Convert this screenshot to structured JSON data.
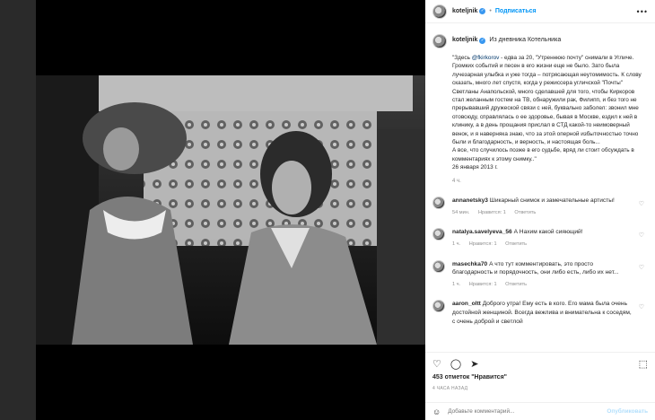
{
  "header": {
    "username": "koteljnik",
    "follow_label": "Подписаться",
    "more": "•••"
  },
  "caption": {
    "username": "koteljnik",
    "location": "Из дневника Котельника",
    "text_before": "\"Здесь ",
    "mention": "@fkirkorov",
    "text_after": " - едва за 20, \"Утреннюю почту\" снимали в Угличе. Громких событий и песен в его жизни еще не было. Зато была лучезарная улыбка и уже тогда – потрясающая неутомимость. К слову сказать, много лет спустя, когда у режиссера угличской \"Почты\" Светланы Анапольской, много сделавшей для того, чтобы Киркоров стал желанным гостем на ТВ, обнаружили рак, Филипп, и без того не прерывавший дружеской связи с ней, буквально заболел: звонил мне отовсюду, справлялась о ее здоровье, бывая в Москве, ездил к ней в клинику, а в день прощания прислал в СТД какой-то неимоверный венок, и я наверняка знаю, что за этой оперной избыточностью точно были и благодарность, и верность, и настоящая боль...\nА все, что случилось позже в его судьбе, вряд ли стоит обсуждать в комментариях к этому снимку..\"\n26 января 2013 г.",
    "age": "4 ч."
  },
  "comments": [
    {
      "user": "annanetsky3",
      "text": "Шикарный снимок и замечательные артисты!",
      "age": "54 мин.",
      "likes": "Нравится: 1",
      "reply": "Ответить"
    },
    {
      "user": "natalya.savelyeva_56",
      "text": "А Нахим какой сияющий!",
      "age": "1 ч.",
      "likes": "Нравится: 1",
      "reply": "Ответить"
    },
    {
      "user": "masechka70",
      "text": "А что тут комментировать, это просто благодарность и порядочность, они либо есть, либо их нет...",
      "age": "1 ч.",
      "likes": "Нравится: 1",
      "reply": "Ответить"
    },
    {
      "user": "aaron_oltt",
      "text": "Доброго утра! Ему есть в кого. Его мама была очень достойной женщиной. Всегда вежлива и внимательна к соседям, с очень доброй и светлой",
      "age": "",
      "likes": "",
      "reply": ""
    }
  ],
  "actions": {
    "likes_text": "453 отметок \"Нравится\"",
    "time": "4 ЧАСА НАЗАД"
  },
  "comment_box": {
    "placeholder": "Добавьте комментарий...",
    "publish": "Опубликовать"
  },
  "icons": {
    "close": "✕",
    "emoji": "☺",
    "heart": "♡",
    "comment": "◯",
    "share": "➤",
    "bookmark": "⬚"
  },
  "colors": {
    "accent": "#0095f6",
    "verified": "#3897f0"
  }
}
